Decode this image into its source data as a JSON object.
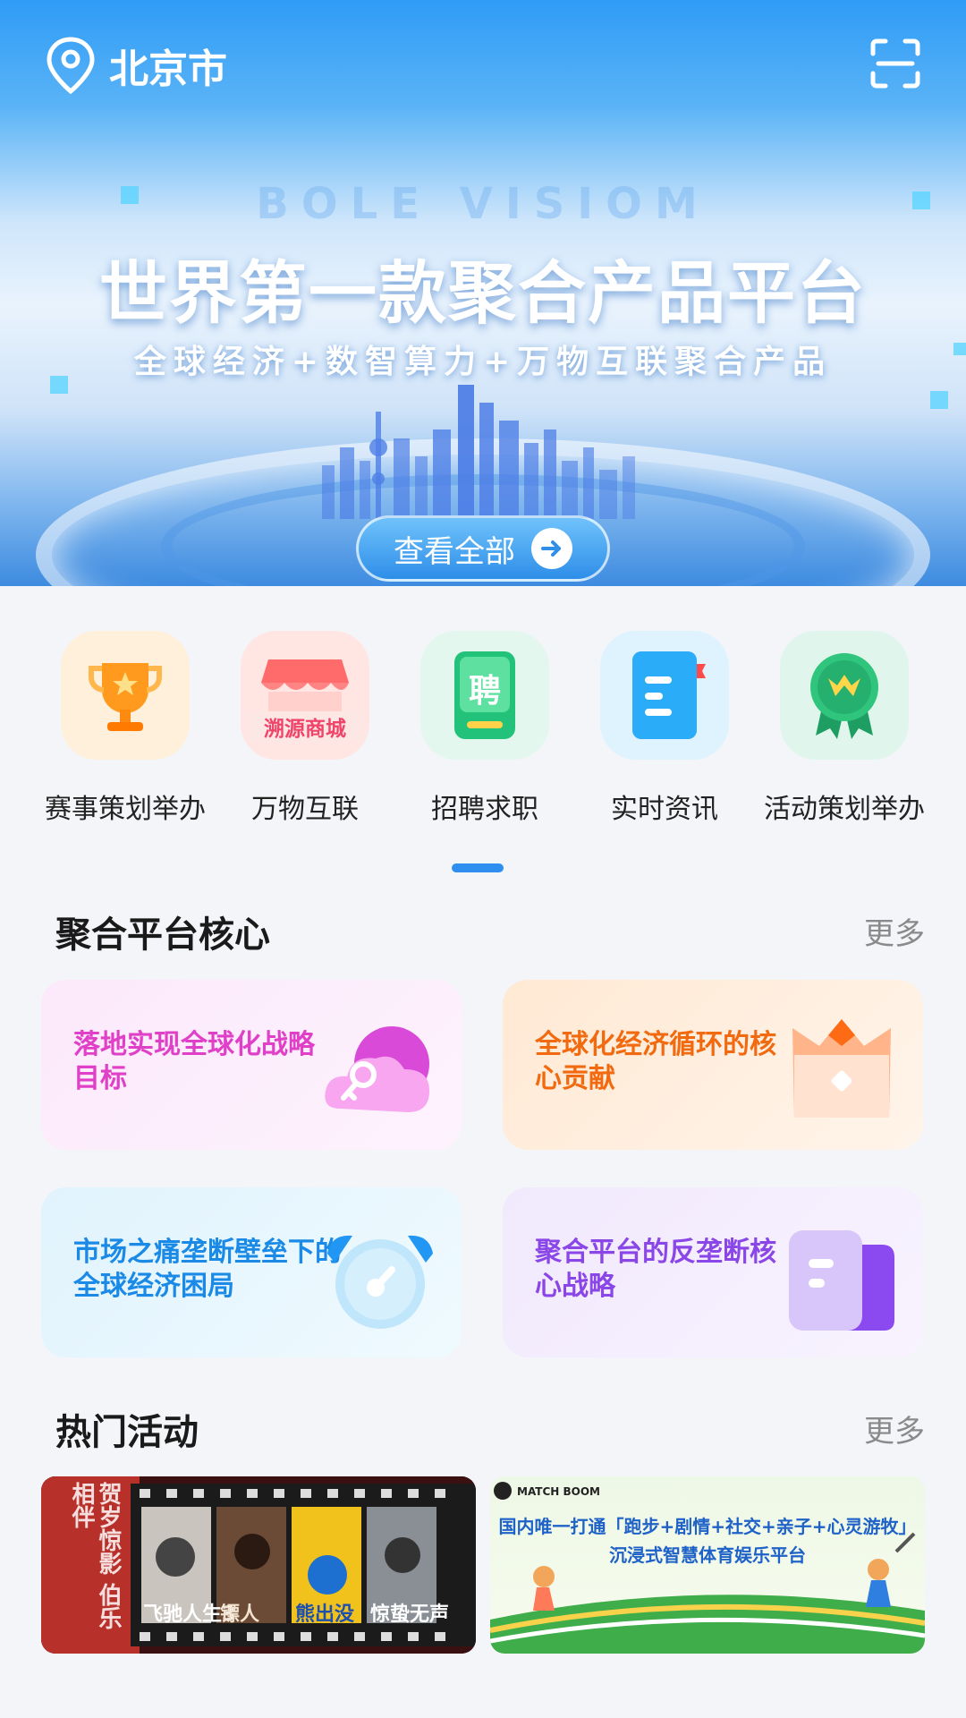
{
  "header": {
    "city": "北京市"
  },
  "banner": {
    "watermark": "BOLE VISIOM",
    "headline": "世界第一款聚合产品平台",
    "subline": "全球经济+数智算力+万物互联聚合产品",
    "view_all": "查看全部"
  },
  "categories": [
    {
      "label": "赛事策划举办",
      "icon": "trophy-icon"
    },
    {
      "label": "万物互联",
      "icon": "store-icon",
      "badge": "溯源商城"
    },
    {
      "label": "招聘求职",
      "icon": "recruit-icon",
      "badge": "聘"
    },
    {
      "label": "实时资讯",
      "icon": "news-icon"
    },
    {
      "label": "活动策划举办",
      "icon": "medal-icon"
    }
  ],
  "core": {
    "title": "聚合平台核心",
    "more": "更多",
    "cards": [
      {
        "text": "落地实现全球化战略目标",
        "color": "#e040c8",
        "icon": "cloud-key-icon"
      },
      {
        "text": "全球化经济循环的核心贡献",
        "color": "#f26a10",
        "icon": "crown-icon"
      },
      {
        "text": "市场之痛垄断壁垒下的全球经济困局",
        "color": "#1a8ae6",
        "icon": "alarm-clock-icon"
      },
      {
        "text": "聚合平台的反垄断核心战略",
        "color": "#8a46e6",
        "icon": "folder-icon"
      }
    ]
  },
  "hot": {
    "title": "热门活动",
    "more": "更多",
    "items": [
      {
        "caption": "贺岁惊影 伯乐相伴",
        "poster_titles": [
          "飞驰人生3",
          "镖人",
          "熊出没",
          "惊蛰无声"
        ]
      },
      {
        "brand": "MATCH BOOM",
        "line1": "国内唯一打通「跑步+剧情+社交+亲子+心灵游牧」",
        "line2": "沉浸式智慧体育娱乐平台"
      }
    ]
  }
}
